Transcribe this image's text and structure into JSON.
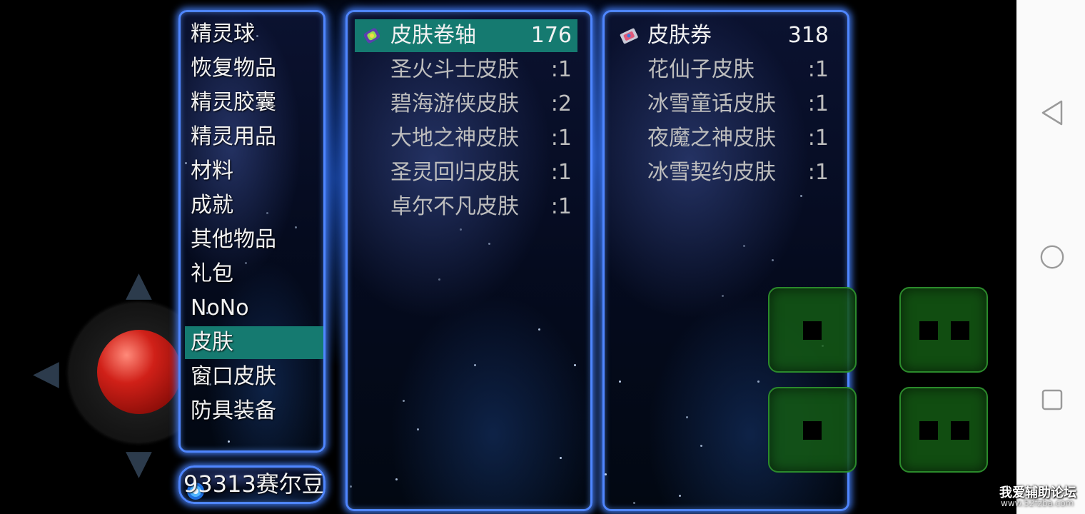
{
  "categories": [
    {
      "label": "精灵球"
    },
    {
      "label": "恢复物品"
    },
    {
      "label": "精灵胶囊"
    },
    {
      "label": "精灵用品"
    },
    {
      "label": "材料"
    },
    {
      "label": "成就"
    },
    {
      "label": "其他物品"
    },
    {
      "label": "礼包"
    },
    {
      "label": "NoNo"
    },
    {
      "label": "皮肤",
      "selected": true
    },
    {
      "label": "窗口皮肤"
    },
    {
      "label": "防具装备"
    }
  ],
  "list_left": {
    "header": {
      "name": "皮肤卷轴",
      "qty": "176",
      "icon": "scroll-icon"
    },
    "items": [
      {
        "name": "圣火斗士皮肤",
        "qty": ":1"
      },
      {
        "name": "碧海游侠皮肤",
        "qty": ":2"
      },
      {
        "name": "大地之神皮肤",
        "qty": ":1"
      },
      {
        "name": "圣灵回归皮肤",
        "qty": ":1"
      },
      {
        "name": "卓尔不凡皮肤",
        "qty": ":1"
      }
    ]
  },
  "list_right": {
    "header": {
      "name": "皮肤券",
      "qty": "318",
      "icon": "ticket-icon"
    },
    "items": [
      {
        "name": "花仙子皮肤",
        "qty": ":1"
      },
      {
        "name": "冰雪童话皮肤",
        "qty": ":1"
      },
      {
        "name": "夜魔之神皮肤",
        "qty": ":1"
      },
      {
        "name": "冰雪契约皮肤",
        "qty": ":1"
      }
    ]
  },
  "currency": {
    "text": "93313赛尔豆",
    "icon": "coin-icon"
  },
  "controls": {
    "dpad": "joystick",
    "buttons": [
      "action-button-1",
      "action-button-2",
      "action-button-3",
      "action-button-4"
    ],
    "button_color": "#1a5a1a"
  },
  "navbar": {
    "back": "back-icon",
    "home": "home-icon",
    "recents": "recents-icon"
  },
  "watermark": {
    "title": "我爱辅助论坛",
    "url": "www.52fzba.com"
  },
  "colors": {
    "selected": "#157a70",
    "panel_border": "#4f86ff"
  }
}
